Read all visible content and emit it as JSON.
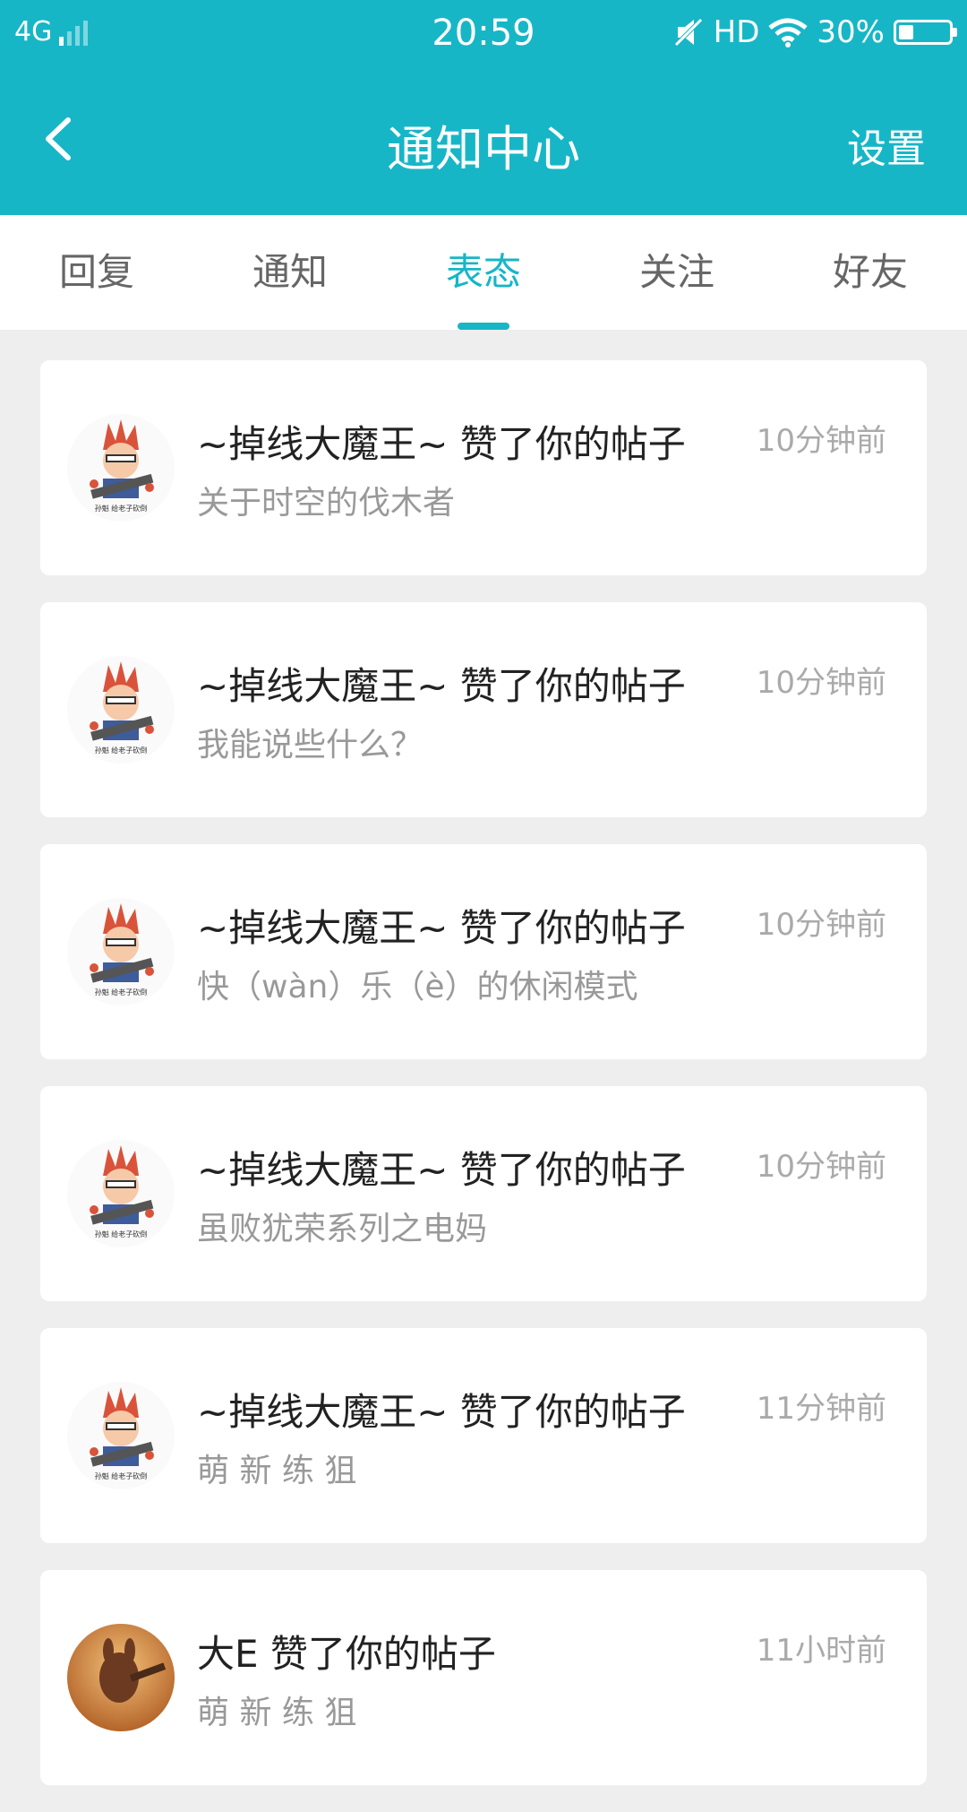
{
  "status_bar": {
    "network": "4G",
    "time": "20:59",
    "hd": "HD",
    "battery": "30%",
    "battery_level": 0.3
  },
  "header": {
    "title": "通知中心",
    "settings_label": "设置"
  },
  "tabs": [
    {
      "label": "回复",
      "active": false
    },
    {
      "label": "通知",
      "active": false
    },
    {
      "label": "表态",
      "active": true
    },
    {
      "label": "关注",
      "active": false
    },
    {
      "label": "好友",
      "active": false
    }
  ],
  "notifications": [
    {
      "title": "~掉线大魔王~ 赞了你的帖子",
      "subtitle": "关于时空的伐木者",
      "time": "10分钟前",
      "avatar": "cartoon-warrior-icon",
      "avatar_caption": "孙魁 给老子砍倒"
    },
    {
      "title": "~掉线大魔王~ 赞了你的帖子",
      "subtitle": "我能说些什么？",
      "time": "10分钟前",
      "avatar": "cartoon-warrior-icon",
      "avatar_caption": "孙魁 给老子砍倒"
    },
    {
      "title": "~掉线大魔王~ 赞了你的帖子",
      "subtitle": "快（wàn）乐（è）的休闲模式",
      "time": "10分钟前",
      "avatar": "cartoon-warrior-icon",
      "avatar_caption": "孙魁 给老子砍倒"
    },
    {
      "title": "~掉线大魔王~ 赞了你的帖子",
      "subtitle": "虽败犹荣系列之电妈",
      "time": "10分钟前",
      "avatar": "cartoon-warrior-icon",
      "avatar_caption": "孙魁 给老子砍倒"
    },
    {
      "title": "~掉线大魔王~ 赞了你的帖子",
      "subtitle": " 萌 新 练 狙",
      "time": "11分钟前",
      "avatar": "cartoon-warrior-icon",
      "avatar_caption": "孙魁 给老子砍倒"
    },
    {
      "title": "大E 赞了你的帖子",
      "subtitle": " 萌 新 练 狙",
      "time": "11小时前",
      "avatar": "game-character-photo-icon"
    }
  ]
}
